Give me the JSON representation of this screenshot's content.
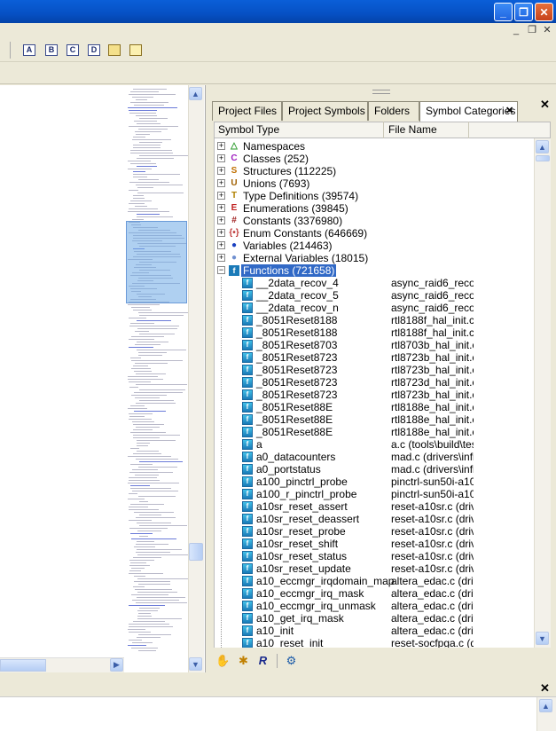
{
  "window": {
    "minimize_glyph": "_",
    "restore_glyph": "❐",
    "close_glyph": "✕"
  },
  "mdi": {
    "minimize_glyph": "_",
    "restore_glyph": "❐",
    "close_glyph": "✕"
  },
  "toolbar": {
    "buttons": [
      {
        "label": "A",
        "icon": "bookmark-a-icon"
      },
      {
        "label": "B",
        "icon": "bookmark-b-icon"
      },
      {
        "label": "C",
        "icon": "bookmark-c-icon"
      },
      {
        "label": "D",
        "icon": "bookmark-d-icon"
      },
      {
        "label": "",
        "icon": "folder-icon"
      },
      {
        "label": "",
        "icon": "notes-icon"
      }
    ]
  },
  "panel": {
    "tabs": [
      "Project Files",
      "Project Symbols",
      "Folders",
      "Symbol Categories"
    ],
    "active_tab": "Symbol Categories",
    "close_glyph": "✕",
    "columns": {
      "symbol_type": "Symbol Type",
      "file_name": "File Name"
    },
    "categories": [
      {
        "label": "Namespaces",
        "icon": "namespace-icon",
        "glyph": "△",
        "color": "#2a9a2a"
      },
      {
        "label": "Classes (252)",
        "icon": "class-icon",
        "glyph": "C",
        "color": "#a020c0"
      },
      {
        "label": "Structures (112225)",
        "icon": "structure-icon",
        "glyph": "S",
        "color": "#c07000"
      },
      {
        "label": "Unions (7693)",
        "icon": "union-icon",
        "glyph": "U",
        "color": "#a06000"
      },
      {
        "label": "Type Definitions (39574)",
        "icon": "typedef-icon",
        "glyph": "T",
        "color": "#b08000"
      },
      {
        "label": "Enumerations (39845)",
        "icon": "enumeration-icon",
        "glyph": "E",
        "color": "#c02020"
      },
      {
        "label": "Constants (3376980)",
        "icon": "constant-icon",
        "glyph": "#",
        "color": "#a02020"
      },
      {
        "label": "Enum Constants (646669)",
        "icon": "enum-constant-icon",
        "glyph": "{•}",
        "color": "#c04040"
      },
      {
        "label": "Variables (214463)",
        "icon": "variable-icon",
        "glyph": "●",
        "color": "#1a40c0"
      },
      {
        "label": "External Variables (18015)",
        "icon": "external-variable-icon",
        "glyph": "●",
        "color": "#7090d0"
      },
      {
        "label": "Functions (721658)",
        "icon": "function-icon",
        "glyph": "f",
        "color": "#1a7ab8",
        "expanded": true,
        "selected": true
      }
    ],
    "functions": [
      {
        "name": "__2data_recov_4",
        "file": "async_raid6_recov"
      },
      {
        "name": "__2data_recov_5",
        "file": "async_raid6_recov"
      },
      {
        "name": "__2data_recov_n",
        "file": "async_raid6_recov"
      },
      {
        "name": "_8051Reset8188",
        "file": "rtl8188f_hal_init.c ("
      },
      {
        "name": "_8051Reset8188",
        "file": "rtl8188f_hal_init.c ("
      },
      {
        "name": "_8051Reset8703",
        "file": "rtl8703b_hal_init.c"
      },
      {
        "name": "_8051Reset8723",
        "file": "rtl8723b_hal_init.c"
      },
      {
        "name": "_8051Reset8723",
        "file": "rtl8723b_hal_init.c"
      },
      {
        "name": "_8051Reset8723",
        "file": "rtl8723d_hal_init.c"
      },
      {
        "name": "_8051Reset8723",
        "file": "rtl8723b_hal_init.c"
      },
      {
        "name": "_8051Reset88E",
        "file": "rtl8188e_hal_init.c"
      },
      {
        "name": "_8051Reset88E",
        "file": "rtl8188e_hal_init.c"
      },
      {
        "name": "_8051Reset88E",
        "file": "rtl8188e_hal_init.c"
      },
      {
        "name": "a",
        "file": "a.c (tools\\build\\tes"
      },
      {
        "name": "a0_datacounters",
        "file": "mad.c (drivers\\infin"
      },
      {
        "name": "a0_portstatus",
        "file": "mad.c (drivers\\infin"
      },
      {
        "name": "a100_pinctrl_probe",
        "file": "pinctrl-sun50i-a100"
      },
      {
        "name": "a100_r_pinctrl_probe",
        "file": "pinctrl-sun50i-a100"
      },
      {
        "name": "a10sr_reset_assert",
        "file": "reset-a10sr.c (drive"
      },
      {
        "name": "a10sr_reset_deassert",
        "file": "reset-a10sr.c (drive"
      },
      {
        "name": "a10sr_reset_probe",
        "file": "reset-a10sr.c (drive"
      },
      {
        "name": "a10sr_reset_shift",
        "file": "reset-a10sr.c (drive"
      },
      {
        "name": "a10sr_reset_status",
        "file": "reset-a10sr.c (drive"
      },
      {
        "name": "a10sr_reset_update",
        "file": "reset-a10sr.c (drive"
      },
      {
        "name": "a10_eccmgr_irqdomain_map",
        "file": "altera_edac.c (drive"
      },
      {
        "name": "a10_eccmgr_irq_mask",
        "file": "altera_edac.c (drive"
      },
      {
        "name": "a10_eccmgr_irq_unmask",
        "file": "altera_edac.c (drive"
      },
      {
        "name": "a10_get_irq_mask",
        "file": "altera_edac.c (drive"
      },
      {
        "name": "a10_init",
        "file": "altera_edac.c (drive"
      },
      {
        "name": "a10_reset_init",
        "file": "reset-socfpga.c (dri"
      }
    ],
    "bottom_icons": [
      "hand-icon",
      "new-symbol-icon",
      "r-icon",
      "gear-icon"
    ]
  },
  "output": {
    "close_glyph": "✕"
  }
}
